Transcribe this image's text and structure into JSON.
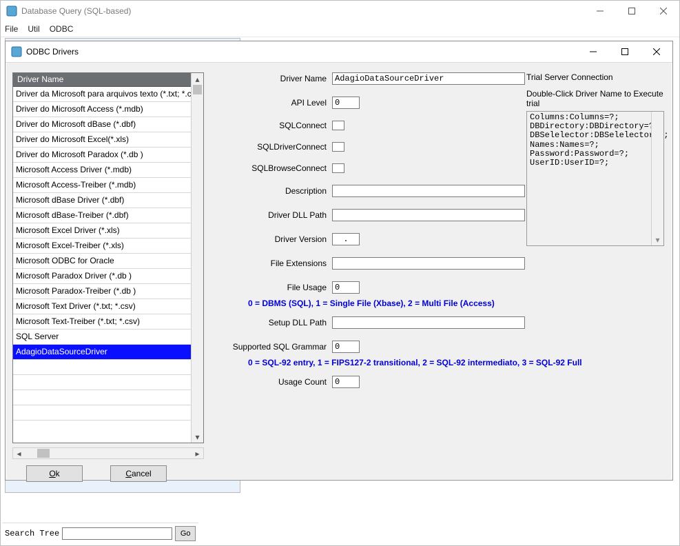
{
  "main": {
    "title": "Database Query (SQL-based)",
    "menus": {
      "file": "File",
      "util": "Util",
      "odbc": "ODBC"
    }
  },
  "dialog": {
    "title": "ODBC Drivers",
    "list_header": "Driver Name",
    "drivers": [
      "Driver da Microsoft para arquivos texto (*.txt; *.csv)",
      "Driver do Microsoft Access (*.mdb)",
      "Driver do Microsoft dBase (*.dbf)",
      "Driver do Microsoft Excel(*.xls)",
      "Driver do Microsoft Paradox (*.db )",
      "Microsoft Access Driver (*.mdb)",
      "Microsoft Access-Treiber (*.mdb)",
      "Microsoft dBase Driver (*.dbf)",
      "Microsoft dBase-Treiber (*.dbf)",
      "Microsoft Excel Driver (*.xls)",
      "Microsoft Excel-Treiber (*.xls)",
      "Microsoft ODBC for Oracle",
      "Microsoft Paradox Driver (*.db )",
      "Microsoft Paradox-Treiber (*.db )",
      "Microsoft Text Driver (*.txt; *.csv)",
      "Microsoft Text-Treiber (*.txt; *.csv)",
      "SQL Server",
      "AdagioDataSourceDriver"
    ],
    "selected_index": 17,
    "buttons": {
      "ok": "Ok",
      "cancel": "Cancel"
    }
  },
  "form": {
    "labels": {
      "driver_name": "Driver Name",
      "api_level": "API Level",
      "sql_connect": "SQLConnect",
      "sql_driver_connect": "SQLDriverConnect",
      "sql_browse_connect": "SQLBrowseConnect",
      "description": "Description",
      "driver_dll_path": "Driver DLL Path",
      "driver_version": "Driver Version",
      "file_extensions": "File Extensions",
      "file_usage": "File Usage",
      "setup_dll_path": "Setup DLL Path",
      "supported_sql_grammar": "Supported SQL Grammar",
      "usage_count": "Usage Count"
    },
    "values": {
      "driver_name": "AdagioDataSourceDriver",
      "api_level": "0",
      "description": "",
      "driver_dll_path": "",
      "driver_version": ".",
      "file_extensions": "",
      "file_usage": "0",
      "setup_dll_path": "",
      "supported_sql_grammar": "0",
      "usage_count": "0"
    },
    "hints": {
      "file_usage": "0 = DBMS (SQL), 1 = Single File (Xbase), 2 = Multi File (Access)",
      "sql_grammar": "0 = SQL-92 entry, 1 = FIPS127-2 transitional, 2 = SQL-92 intermediato, 3 = SQL-92 Full"
    }
  },
  "trial": {
    "heading": "Trial Server Connection",
    "subheading": "Double-Click Driver Name to Execute trial",
    "text": "Columns:Columns=?;\nDBDirectory:DBDirectory=?;\nDBSelelector:DBSelelector=?;\nNames:Names=?;\nPassword:Password=?;\nUserID:UserID=?;"
  },
  "search": {
    "label": "Search Tree",
    "go": "Go",
    "value": ""
  }
}
